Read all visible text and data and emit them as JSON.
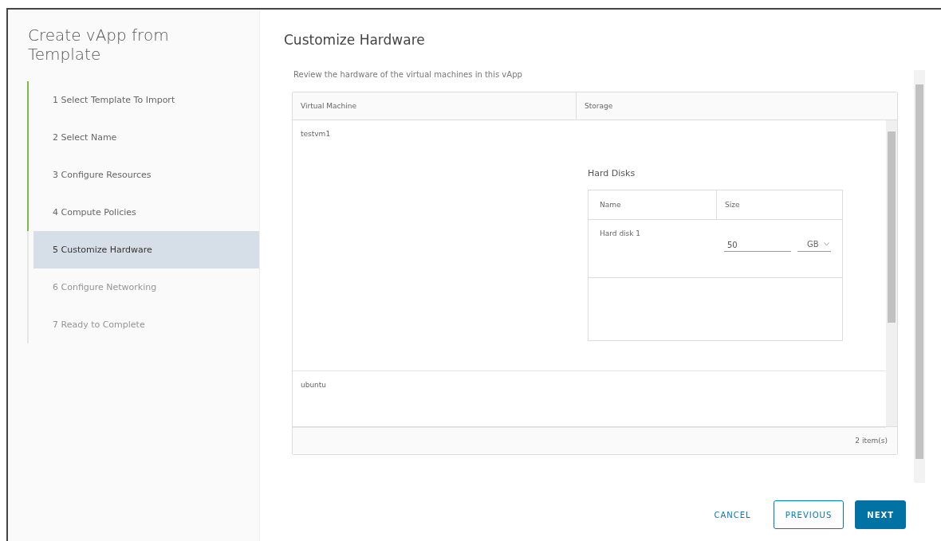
{
  "wizard": {
    "title": "Create vApp from Template",
    "steps": [
      {
        "label": "1  Select Template To Import",
        "completed": true,
        "selected": false,
        "disabled": false
      },
      {
        "label": "2  Select Name",
        "completed": true,
        "selected": false,
        "disabled": false
      },
      {
        "label": "3  Configure Resources",
        "completed": true,
        "selected": false,
        "disabled": false
      },
      {
        "label": "4  Compute Policies",
        "completed": true,
        "selected": false,
        "disabled": false
      },
      {
        "label": "5  Customize Hardware",
        "completed": false,
        "selected": true,
        "disabled": false
      },
      {
        "label": "6  Configure Networking",
        "completed": false,
        "selected": false,
        "disabled": true
      },
      {
        "label": "7  Ready to Complete",
        "completed": false,
        "selected": false,
        "disabled": true
      }
    ]
  },
  "page": {
    "title": "Customize Hardware",
    "description": "Review the hardware of the virtual machines in this vApp"
  },
  "table": {
    "columns": [
      "Virtual Machine",
      "Storage"
    ],
    "rows": [
      {
        "name": "testvm1",
        "hard_disks": {
          "title": "Hard Disks",
          "columns": [
            "Name",
            "Size"
          ],
          "rows": [
            {
              "name": "Hard disk 1",
              "size": "50",
              "unit": "GB"
            }
          ]
        }
      },
      {
        "name": "ubuntu"
      }
    ],
    "footer": "2 item(s)"
  },
  "buttons": [
    {
      "label": "CANCEL",
      "kind": "flat"
    },
    {
      "label": "PREVIOUS",
      "kind": "outline"
    },
    {
      "label": "NEXT",
      "kind": "primary"
    }
  ]
}
